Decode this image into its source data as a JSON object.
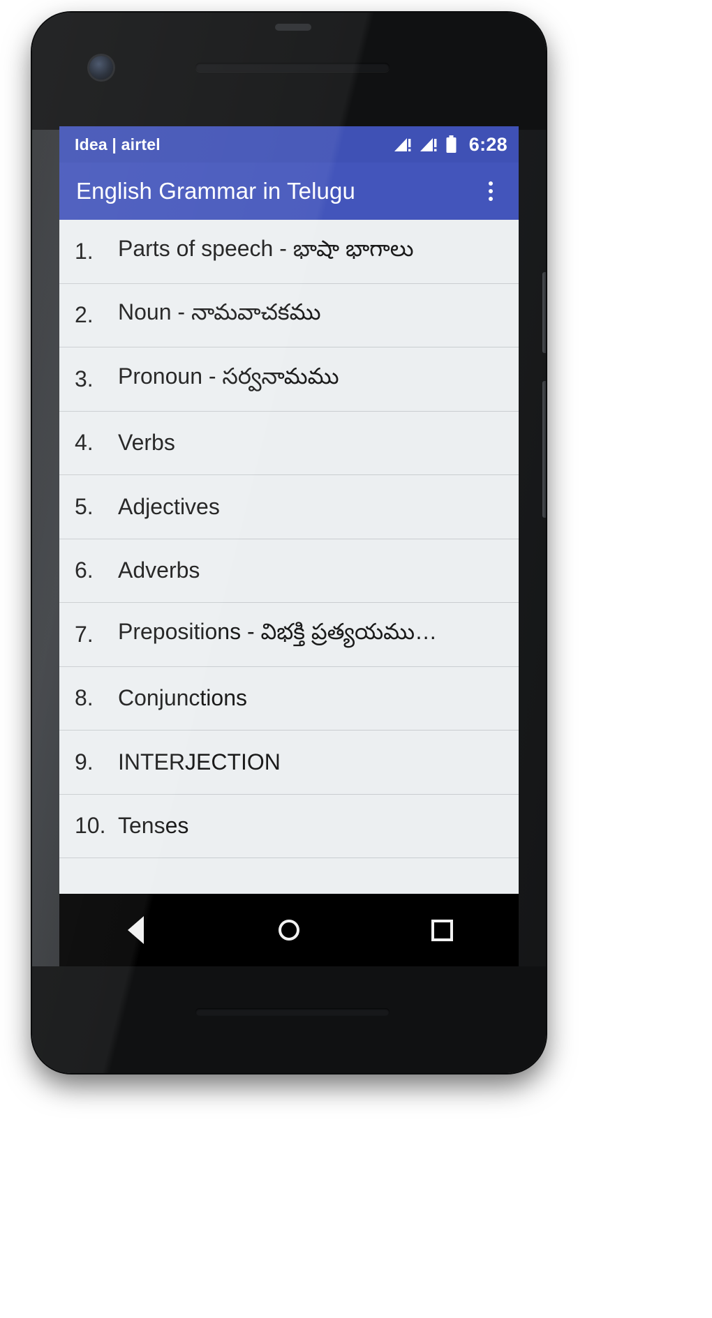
{
  "status_bar": {
    "carrier": "Idea | airtel",
    "clock": "6:28",
    "signal_icon_1": "signal-bars-warning-icon",
    "signal_icon_2": "signal-bars-warning-icon",
    "battery_icon": "battery-full-icon",
    "background_color": "#3f51b5"
  },
  "app_bar": {
    "title": "English Grammar in Telugu",
    "overflow_icon": "overflow-menu-icon",
    "background_color": "#4355bb",
    "text_color": "#ffffff"
  },
  "list": {
    "items": [
      {
        "index": "1.",
        "label": "Parts of speech - భాషా భాగాలు"
      },
      {
        "index": "2.",
        "label": "Noun - నామవాచకము"
      },
      {
        "index": "3.",
        "label": "Pronoun - సర్వనామము"
      },
      {
        "index": "4.",
        "label": "Verbs"
      },
      {
        "index": "5.",
        "label": "Adjectives"
      },
      {
        "index": "6.",
        "label": "Adverbs"
      },
      {
        "index": "7.",
        "label": "Prepositions - విభక్తి ప్రత్యయము…"
      },
      {
        "index": "8.",
        "label": "Conjunctions"
      },
      {
        "index": "9.",
        "label": "INTERJECTION"
      },
      {
        "index": "10.",
        "label": "Tenses"
      }
    ]
  },
  "nav_bar": {
    "back_icon": "back-triangle-icon",
    "home_icon": "home-circle-icon",
    "recents_icon": "recents-square-icon"
  },
  "device": {
    "front_camera_icon": "front-camera-icon",
    "earpiece_icon": "earpiece-speaker-icon",
    "power_button": "power-button",
    "volume_button": "volume-button"
  }
}
